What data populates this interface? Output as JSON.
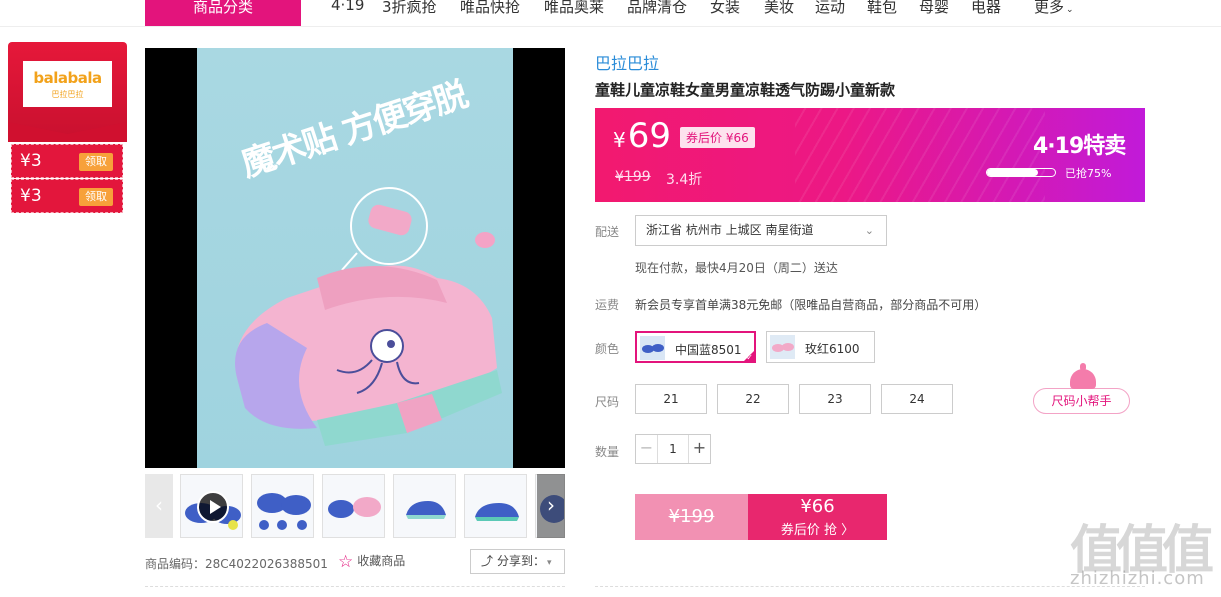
{
  "nav": {
    "category_button": "商品分类",
    "items": [
      "4·19",
      "3折疯抢",
      "唯品快抢",
      "唯品奥莱",
      "品牌清仓",
      "女装",
      "美妆",
      "运动",
      "鞋包",
      "母婴",
      "电器",
      "更多"
    ]
  },
  "store_panel": {
    "logo_text": "balabala",
    "logo_sub": "巴拉巴拉",
    "coupons": [
      {
        "amount": "¥3",
        "action": "领取"
      },
      {
        "amount": "¥3",
        "action": "领取"
      }
    ]
  },
  "gallery": {
    "hero_text": "魔术贴 方便穿脱",
    "thumbnails": [
      "video",
      "pair-top",
      "pair-set",
      "pink-side",
      "blue-side",
      "blue-front"
    ],
    "sku_label": "商品编码：28C4022026388501",
    "favorite_label": "收藏商品",
    "share_label": "分享到：",
    "colors": {
      "accent": "#e3147c"
    }
  },
  "product": {
    "brand": "巴拉巴拉",
    "title": "童鞋儿童凉鞋女童男童凉鞋透气防踢小童新款",
    "price": {
      "currency": "¥",
      "current": "69",
      "coupon_price": "券后价 ¥66",
      "original": "¥199",
      "discount": "3.4折"
    },
    "event": {
      "title": "4·19特卖",
      "sold_percent": 75,
      "sold_text": "已抢75%"
    },
    "delivery": {
      "label": "配送",
      "address": "浙江省 杭州市 上城区 南星街道",
      "hint": "现在付款，最快4月20日（周二）送达"
    },
    "shipping": {
      "label": "运费",
      "text": "新会员专享首单满38元免邮（限唯品自营商品，部分商品不可用）"
    },
    "color": {
      "label": "颜色",
      "options": [
        {
          "name": "中国蓝8501",
          "selected": true
        },
        {
          "name": "玫红6100",
          "selected": false
        }
      ]
    },
    "size": {
      "label": "尺码",
      "options": [
        "21",
        "22",
        "23",
        "24"
      ],
      "helper": "尺码小帮手"
    },
    "quantity": {
      "label": "数量",
      "value": "1",
      "minus": "−",
      "plus": "+"
    },
    "buy": {
      "original": "¥199",
      "price": "¥66",
      "label": "券后价 抢 〉"
    }
  },
  "watermark": {
    "glyphs": "值值值",
    "domain": "zhizhizhi.com"
  }
}
